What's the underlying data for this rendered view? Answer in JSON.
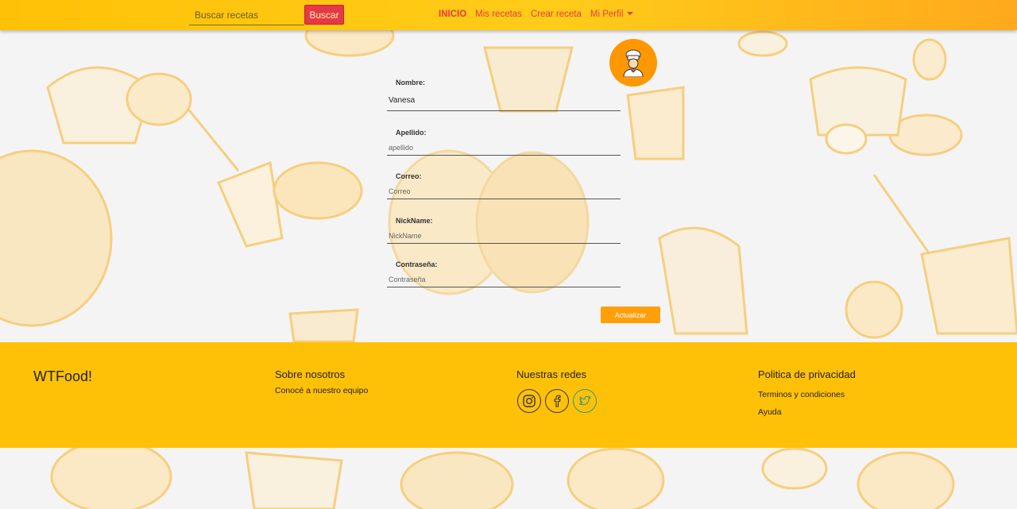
{
  "navbar": {
    "search": {
      "placeholder": "Buscar recetas",
      "button_label": "Buscar"
    },
    "links": [
      {
        "label": "INICIO",
        "active": true
      },
      {
        "label": "Mis recetas",
        "active": false
      },
      {
        "label": "Crear receta",
        "active": false
      },
      {
        "label": "Mi Perfil",
        "active": false,
        "dropdown": true
      }
    ],
    "colors": {
      "link": "#e43b3b",
      "bar": "#ffc107",
      "search_button": "#e53947"
    }
  },
  "avatar": {
    "icon": "chef-icon",
    "color": "#ff9800"
  },
  "profile_form": {
    "fields": [
      {
        "label": "Nombre:",
        "value": "Vanesa",
        "placeholder": ""
      },
      {
        "label": "Apellido:",
        "value": "",
        "placeholder": "apellido"
      },
      {
        "label": "Correo:",
        "value": "",
        "placeholder": "Correo"
      },
      {
        "label": "NickName:",
        "value": "",
        "placeholder": "NickName"
      },
      {
        "label": "Contraseña:",
        "value": "",
        "placeholder": "Contraseña"
      }
    ],
    "submit_label": "Actualizar",
    "submit_color": "#ff9f0a"
  },
  "footer": {
    "brand": "WTFood!",
    "about": {
      "title": "Sobre nosotros",
      "link": "Conocé a nuestro equipo"
    },
    "social": {
      "title": "Nuestras redes",
      "icons": [
        "instagram-icon",
        "facebook-icon",
        "twitter-icon"
      ]
    },
    "privacy": {
      "title": "Politica de privacidad",
      "links": [
        "Terminos y condiciones",
        "Ayuda"
      ]
    },
    "color": "#ffc107"
  }
}
